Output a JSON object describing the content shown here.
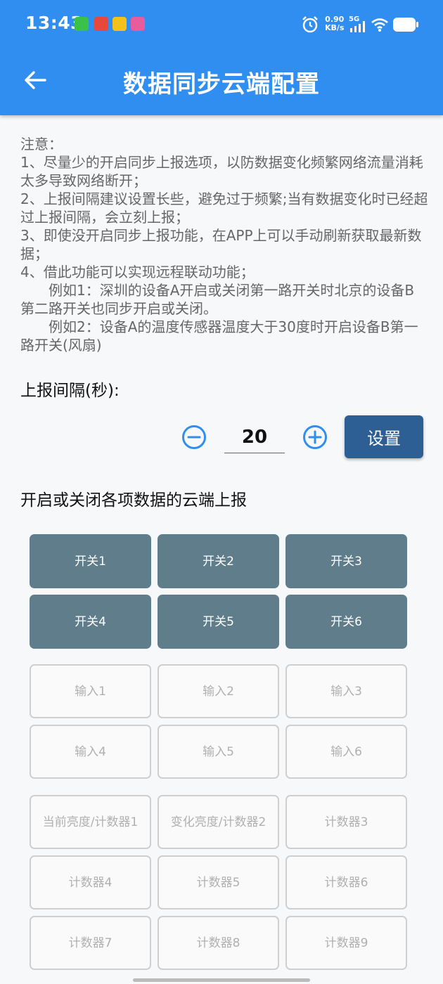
{
  "status_bar": {
    "time": "13:43",
    "speed_value": "0.90",
    "speed_unit": "KB/s",
    "network": "5G",
    "notif_colors": [
      "#3bc14a",
      "#e8473b",
      "#f2c21a",
      "#e75c9c"
    ]
  },
  "header": {
    "title": "数据同步云端配置",
    "background": "#2f8eef"
  },
  "notes": [
    "注意：",
    "1、尽量少的开启同步上报选项，以防数据变化频繁网络流量消耗太多导致网络断开；",
    "2、上报间隔建议设置长些，避免过于频繁;当有数据变化时已经超过上报间隔，会立刻上报；",
    "3、即使没开启同步上报功能，在APP上可以手动刷新获取最新数据；",
    "4、借此功能可以实现远程联动功能；",
    "例如1：深圳的设备A开启或关闭第一路开关时北京的设备B第二路开关也同步开启或关闭。",
    "例如2：设备A的温度传感器温度大于30度时开启设备B第一路开关(风扇)"
  ],
  "interval": {
    "label": "上报间隔(秒):",
    "value": "20",
    "set_label": "设置"
  },
  "section_title": "开启或关闭各项数据的云端上报",
  "switch_group": [
    {
      "label": "开关1",
      "on": true
    },
    {
      "label": "开关2",
      "on": true
    },
    {
      "label": "开关3",
      "on": true
    },
    {
      "label": "开关4",
      "on": true
    },
    {
      "label": "开关5",
      "on": true
    },
    {
      "label": "开关6",
      "on": true
    }
  ],
  "input_group": [
    {
      "label": "输入1",
      "on": false
    },
    {
      "label": "输入2",
      "on": false
    },
    {
      "label": "输入3",
      "on": false
    },
    {
      "label": "输入4",
      "on": false
    },
    {
      "label": "输入5",
      "on": false
    },
    {
      "label": "输入6",
      "on": false
    }
  ],
  "counter_group": [
    {
      "label": "当前亮度/计数器1",
      "on": false
    },
    {
      "label": "变化亮度/计数器2",
      "on": false
    },
    {
      "label": "计数器3",
      "on": false
    },
    {
      "label": "计数器4",
      "on": false
    },
    {
      "label": "计数器5",
      "on": false
    },
    {
      "label": "计数器6",
      "on": false
    },
    {
      "label": "计数器7",
      "on": false
    },
    {
      "label": "计数器8",
      "on": false
    },
    {
      "label": "计数器9",
      "on": false
    }
  ],
  "colors": {
    "toggle_on": "#607d8b",
    "toggle_off_border": "#cfcfcf",
    "accent_blue": "#2f8eef",
    "button_dark": "#2d5f95"
  }
}
